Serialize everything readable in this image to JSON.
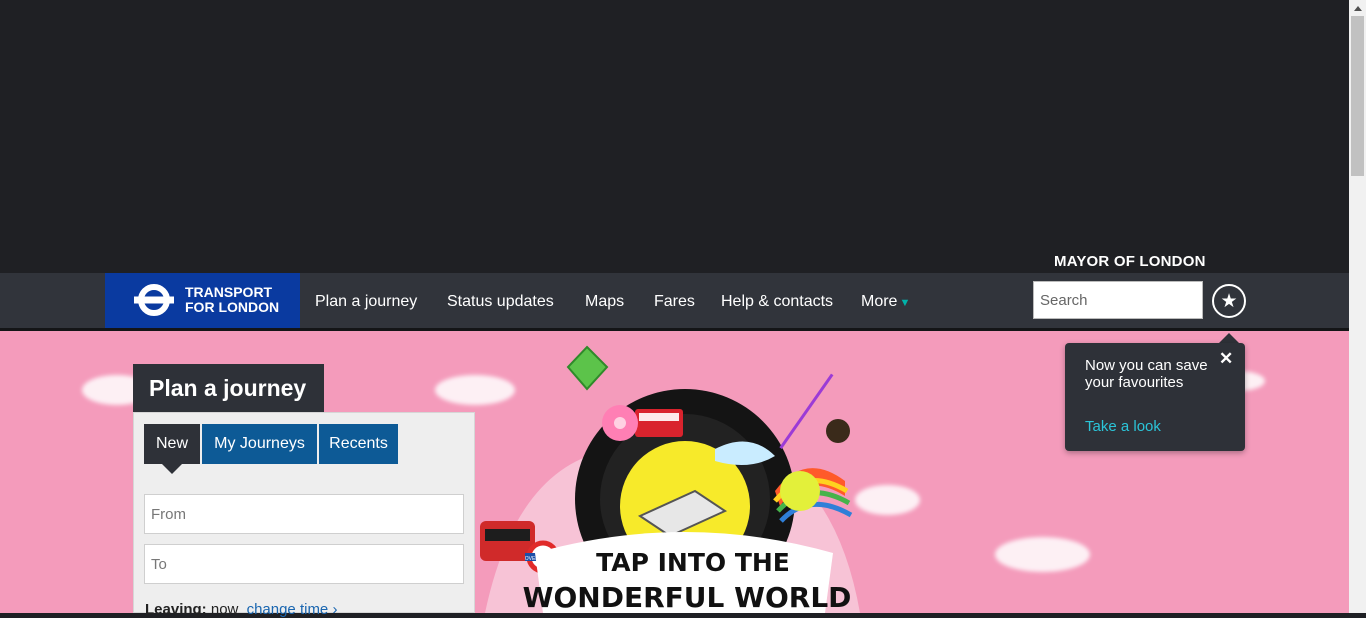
{
  "header": {
    "mayor": "MAYOR OF LONDON",
    "logo_line1": "TRANSPORT",
    "logo_line2": "FOR LONDON",
    "nav": [
      "Plan a journey",
      "Status updates",
      "Maps",
      "Fares",
      "Help & contacts",
      "More"
    ],
    "search_placeholder": "Search"
  },
  "planner": {
    "title": "Plan a journey",
    "tabs": [
      "New",
      "My Journeys",
      "Recents"
    ],
    "from_placeholder": "From",
    "to_placeholder": "To",
    "leaving_label": "Leaving:",
    "leaving_value": "now",
    "change_time": "change time"
  },
  "promo": {
    "line1": "TAP INTO THE",
    "line2": "WONDERFUL WORLD",
    "overground": "OVERGROUND"
  },
  "tooltip": {
    "message": "Now you can save your favourites",
    "link": "Take a look",
    "close": "✕"
  },
  "colors": {
    "hero_bg": "#f49bbb",
    "nav_bg": "#31343b",
    "tfl_blue": "#0a3aa0",
    "tab_blue": "#0d5a96",
    "link_teal": "#2bc4d8"
  },
  "icons": {
    "favourites": "star-icon",
    "tooltip_close": "close-icon",
    "more": "chevron-down-icon",
    "change_time": "chevron-right-icon"
  }
}
